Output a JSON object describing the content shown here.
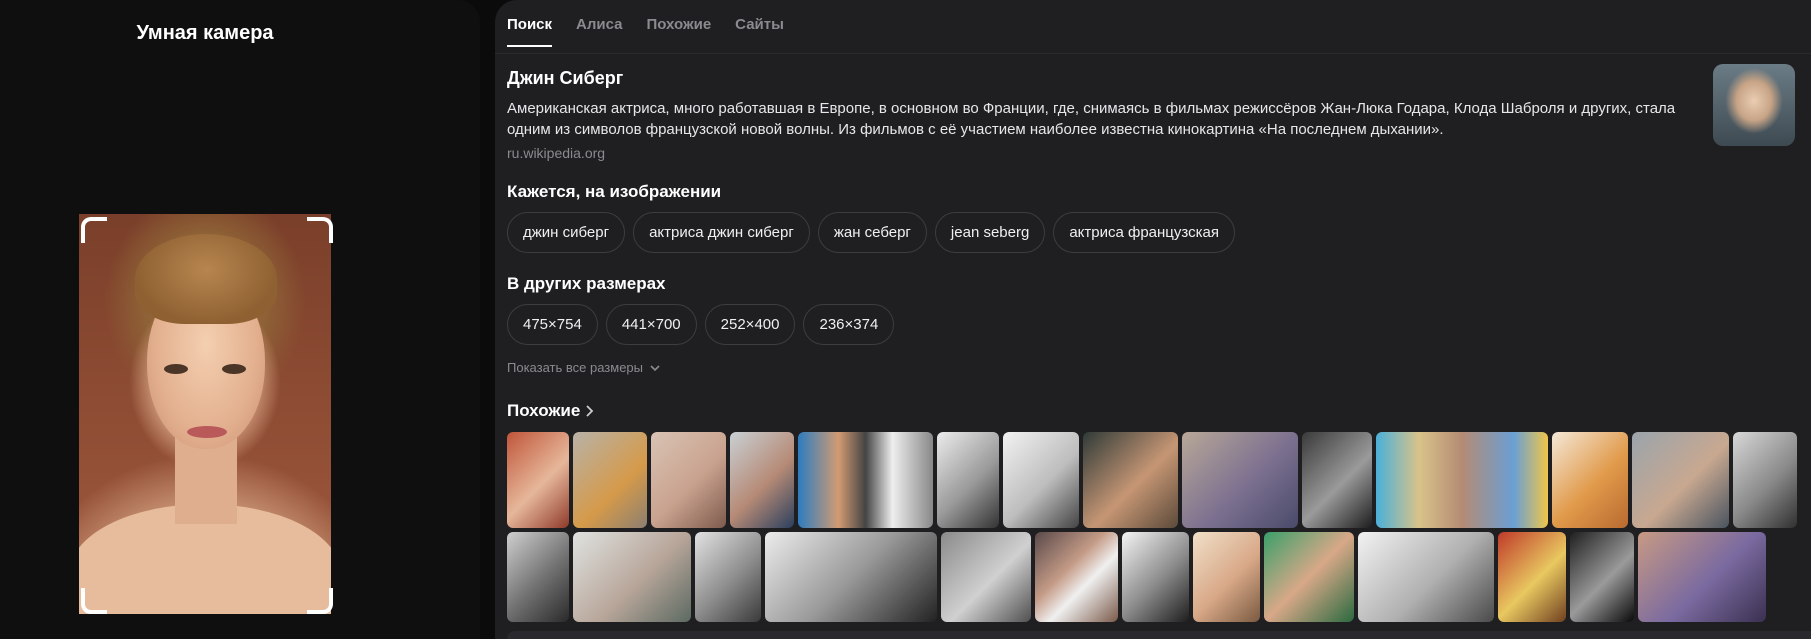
{
  "left": {
    "title": "Умная камера"
  },
  "tabs": [
    {
      "label": "Поиск",
      "active": true
    },
    {
      "label": "Алиса",
      "active": false
    },
    {
      "label": "Похожие",
      "active": false
    },
    {
      "label": "Сайты",
      "active": false
    }
  ],
  "entity": {
    "title": "Джин Сиберг",
    "description": "Американская актриса, много работавшая в Европе, в основном во Франции, где, снимаясь в фильмах режиссёров Жан-Люка Годара, Клода Шаброля и других, стала одним из символов французской новой волны. Из фильмов с её участием наиболее известна кинокартина «На последнем дыхании».",
    "source": "ru.wikipedia.org"
  },
  "seems": {
    "title": "Кажется, на изображении",
    "chips": [
      "джин сиберг",
      "актриса джин сиберг",
      "жан себерг",
      "jean seberg",
      "актриса французская"
    ]
  },
  "sizes": {
    "title": "В других размерах",
    "chips": [
      "475×754",
      "441×700",
      "252×400",
      "236×374"
    ],
    "show_all": "Показать все размеры"
  },
  "similar": {
    "title": "Похожие"
  },
  "colors": {
    "panel_bg": "#1f1f22",
    "left_bg": "#0f0f10",
    "chip_border": "#3c3c41",
    "muted_text": "#8a8a8f"
  }
}
